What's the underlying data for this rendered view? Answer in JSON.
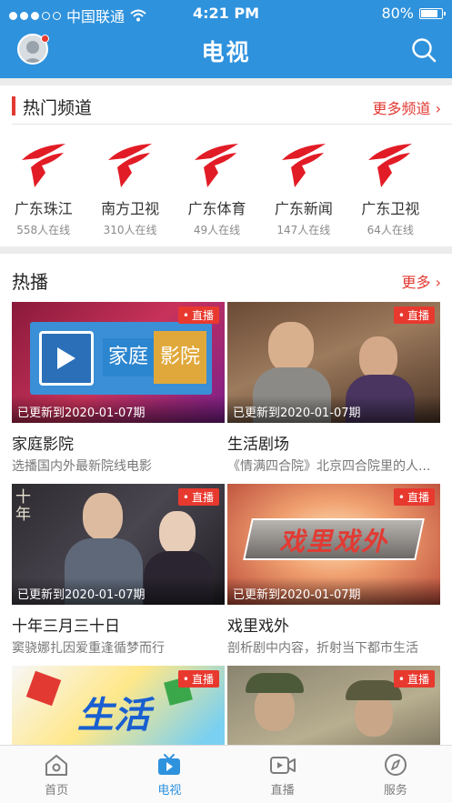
{
  "status_bar": {
    "carrier": "中国联通",
    "time": "4:21 PM",
    "battery": "80%",
    "battery_level": 0.8
  },
  "nav": {
    "title": "电视"
  },
  "hot_channels": {
    "title": "热门频道",
    "more": "更多频道 ›",
    "items": [
      {
        "name": "广东珠江",
        "viewers": "558人在线"
      },
      {
        "name": "南方卫视",
        "viewers": "310人在线"
      },
      {
        "name": "广东体育",
        "viewers": "49人在线"
      },
      {
        "name": "广东新闻",
        "viewers": "147人在线"
      },
      {
        "name": "广东卫视",
        "viewers": "64人在线"
      }
    ]
  },
  "hot_broadcast": {
    "title": "热播",
    "more": "更多 ›",
    "live_label": "直播",
    "cards": [
      {
        "update": "已更新到2020-01-07期",
        "title": "家庭影院",
        "desc": "选播国内外最新院线电影",
        "thumb_text_1": "家庭",
        "thumb_text_2": "影院"
      },
      {
        "update": "已更新到2020-01-07期",
        "title": "生活剧场",
        "desc": "《情满四合院》北京四合院里的人..."
      },
      {
        "update": "已更新到2020-01-07期",
        "title": "十年三月三十日",
        "desc": "窦骁娜扎因爱重逢循梦而行",
        "thumb_text": "十年"
      },
      {
        "update": "已更新到2020-01-07期",
        "title": "戏里戏外",
        "desc": "剖析剧中内容，折射当下都市生活",
        "thumb_text": "戏里戏外"
      },
      {
        "thumb_text": "生活"
      },
      {}
    ]
  },
  "tabbar": {
    "items": [
      {
        "label": "首页",
        "icon": "home-icon"
      },
      {
        "label": "电视",
        "icon": "tv-icon",
        "active": true
      },
      {
        "label": "直播",
        "icon": "live-camera-icon"
      },
      {
        "label": "服务",
        "icon": "compass-icon"
      }
    ]
  },
  "colors": {
    "primary": "#2f92dd",
    "accent_red": "#e23a33",
    "live_badge": "#e8392f"
  }
}
